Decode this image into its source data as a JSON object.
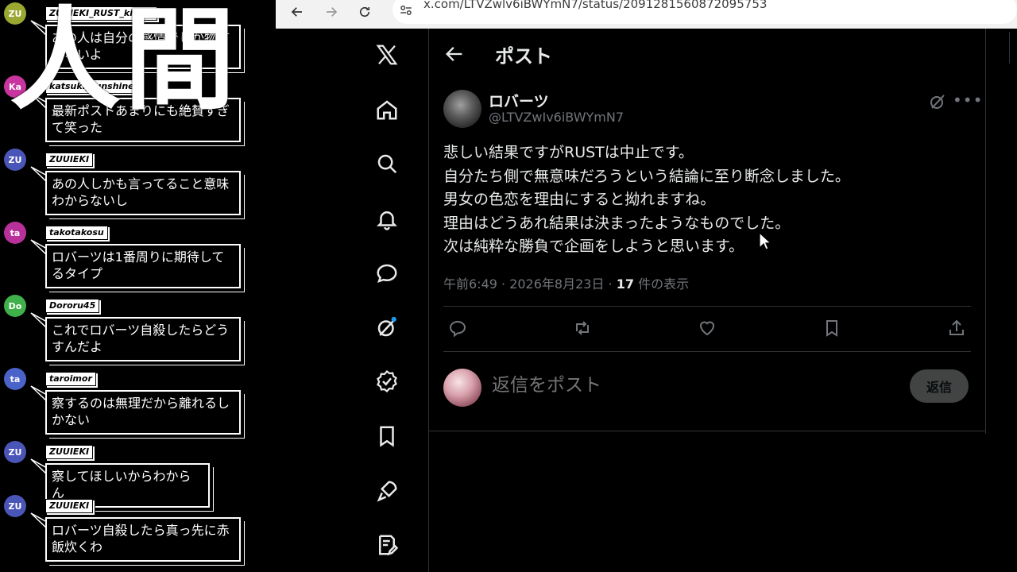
{
  "browser": {
    "url": "x.com/LTVZwlv6iBWYmN7/status/2091281560872095753"
  },
  "post": {
    "header_title": "ポスト",
    "display_name": "ロバーツ",
    "handle": "@LTVZwIv6iBWYmN7",
    "body_lines": [
      "悲しい結果ですがRUSTは中止です。",
      "自分たち側で無意味だろうという結論に至り断念しました。",
      "男女の色恋を理由にすると拗れますね。",
      "理由はどうあれ結果は決まったようなものでした。",
      "次は純粋な勝負で企画をしようと思います。"
    ],
    "meta_time": "午前6:49 · 2026年8月23日 · ",
    "views_count": "17",
    "views_label": " 件の表示",
    "reply_placeholder": "返信をポスト",
    "reply_button": "返信"
  },
  "overlay": {
    "big_title": "人間"
  },
  "chat": {
    "messages": [
      {
        "initials": "ZU",
        "color": "#9aa832",
        "user": "ZUUIEKI_RUST_kicktv",
        "lines": [
          "あの人は自分の感情でしか物言",
          "わないよ"
        ]
      },
      {
        "initials": "Ka",
        "color": "#c8359e",
        "user": "katsuki_sunshine",
        "lines": [
          "最新ポストあまりにも絶賛すぎ",
          "て笑った"
        ]
      },
      {
        "initials": "ZU",
        "color": "#4a55b8",
        "user": "ZUUIEKI",
        "lines": [
          "あの人しかも言ってること意味",
          "わからないし"
        ]
      },
      {
        "initials": "ta",
        "color": "#b8309a",
        "user": "takotakosu",
        "lines": [
          "ロバーツは1番周りに期待して",
          "るタイプ"
        ]
      },
      {
        "initials": "Do",
        "color": "#3fb04a",
        "user": "Dororu45",
        "lines": [
          "これでロバーツ自殺したらどう",
          "すんだよ"
        ]
      },
      {
        "initials": "ta",
        "color": "#4a63c8",
        "user": "taroimor",
        "lines": [
          "察するのは無理だから離れるし",
          "かない"
        ]
      },
      {
        "initials": "ZU",
        "color": "#4a55b8",
        "user": "ZUUIEKI",
        "lines": [
          "察してほしいからわからん"
        ]
      },
      {
        "initials": "ZU",
        "color": "#4a55b8",
        "user": "ZUUIEKI",
        "lines": [
          "ロバーツ自殺したら真っ先に赤",
          "飯炊くわ"
        ]
      }
    ]
  },
  "icons": {
    "sidebar": [
      "x-logo-icon",
      "home-icon",
      "search-icon",
      "bell-icon",
      "message-icon",
      "grok-icon",
      "verified-icon",
      "bookmark-icon",
      "rocket-icon",
      "compose-icon"
    ],
    "actions": [
      "reply-icon",
      "repost-icon",
      "like-icon",
      "bookmark-icon",
      "share-icon"
    ]
  },
  "colors": {
    "background": "#000000",
    "text_primary": "#e7e9ea",
    "text_secondary": "#71767b",
    "divider": "#2f3336",
    "notification_dot": "#1d9bf0"
  }
}
